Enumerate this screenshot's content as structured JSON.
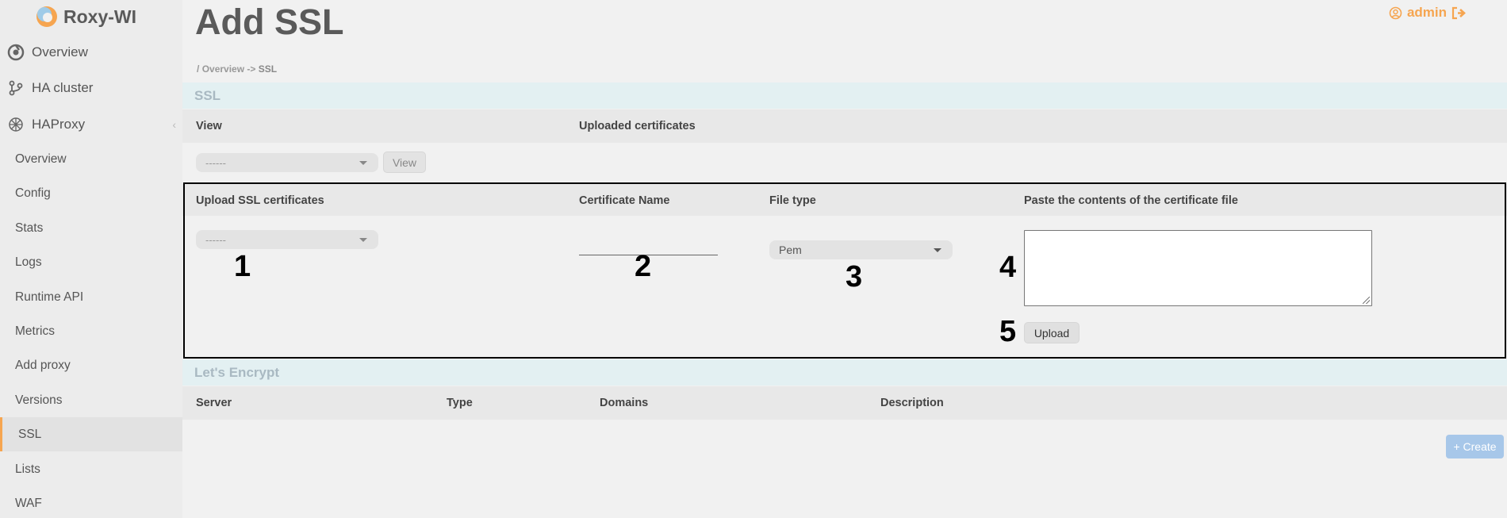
{
  "brand": {
    "name": "Roxy-WI"
  },
  "sidebar": {
    "top_items": [
      {
        "label": "Overview",
        "icon": "overview-icon"
      },
      {
        "label": "HA cluster",
        "icon": "branch-icon"
      },
      {
        "label": "HAProxy",
        "icon": "haproxy-icon"
      }
    ],
    "collapse_glyph": "‹",
    "sub_items": [
      {
        "label": "Overview"
      },
      {
        "label": "Config"
      },
      {
        "label": "Stats"
      },
      {
        "label": "Logs"
      },
      {
        "label": "Runtime API"
      },
      {
        "label": "Metrics"
      },
      {
        "label": "Add proxy"
      },
      {
        "label": "Versions"
      },
      {
        "label": "SSL",
        "active": true
      },
      {
        "label": "Lists"
      },
      {
        "label": "WAF"
      }
    ]
  },
  "header": {
    "title": "Add SSL",
    "user": "admin"
  },
  "breadcrumb": {
    "sep": "/",
    "parent": "Overview",
    "arrow": "->",
    "current": "SSL"
  },
  "ssl_section": {
    "title": "SSL",
    "view_header": "View",
    "uploaded_header": "Uploaded certificates",
    "view_select_value": "------",
    "view_button": "View"
  },
  "upload": {
    "col_upload": "Upload SSL certificates",
    "col_name": "Certificate Name",
    "col_type": "File type",
    "col_paste": "Paste the contents of the certificate file",
    "server_select_value": "------",
    "file_type_value": "Pem",
    "upload_button": "Upload",
    "markers": [
      "1",
      "2",
      "3",
      "4",
      "5"
    ]
  },
  "letsencrypt": {
    "title": "Let's Encrypt",
    "columns": [
      "Server",
      "Type",
      "Domains",
      "Description"
    ],
    "create_button": "+ Create"
  },
  "colors": {
    "accent": "#f6a550",
    "section_bg": "#e3f0f2",
    "create_btn": "#a7c7e9"
  }
}
